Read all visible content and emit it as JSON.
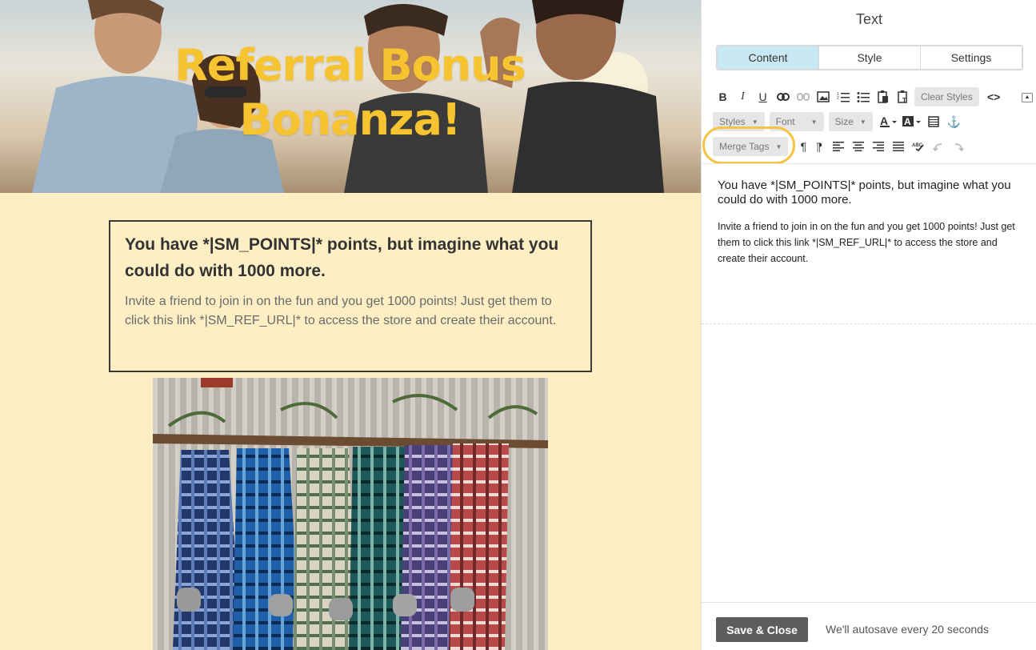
{
  "preview": {
    "hero_title": "Referral Bonus Bonanza!",
    "block_heading": "You have *|SM_POINTS|* points, but imagine what you could do with 1000 more.",
    "block_body": "Invite a friend to join in on the fun and you get 1000 points! Just get them to click this link *|SM_REF_URL|* to access the store and create their account."
  },
  "panel": {
    "title": "Text",
    "tabs": [
      {
        "label": "Content",
        "active": true
      },
      {
        "label": "Style",
        "active": false
      },
      {
        "label": "Settings",
        "active": false
      }
    ],
    "toolbar": {
      "clear_styles": "Clear Styles",
      "styles": "Styles",
      "font": "Font",
      "size": "Size",
      "merge_tags": "Merge Tags"
    },
    "editor": {
      "heading": "You have *|SM_POINTS|* points, but imagine what you could do with 1000 more.",
      "body": "Invite a friend to join in on the fun and you get 1000 points! Just get them to click this link *|SM_REF_URL|* to access the store and create their account."
    },
    "footer": {
      "save_label": "Save & Close",
      "autosave_text": "We'll autosave every 20 seconds"
    }
  },
  "colors": {
    "accent_tab": "#c8e9f4",
    "hero_title": "#f7c431",
    "preview_bg": "#fdeec4",
    "highlight_ring": "#f4c542"
  }
}
